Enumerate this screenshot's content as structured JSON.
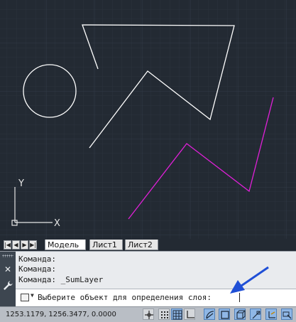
{
  "layout_tabs": [
    {
      "label": "Модель",
      "active": true
    },
    {
      "label": "Лист1",
      "active": false
    },
    {
      "label": "Лист2",
      "active": false
    }
  ],
  "nav_buttons": [
    "first",
    "previous",
    "next",
    "last"
  ],
  "command_history": [
    "Команда:",
    "Команда:",
    "Команда: _SumLayer"
  ],
  "command_prompt": "Выберите объект для определения слоя:",
  "status_bar": {
    "coordinates": "1253.1179, 1256.3477, 0.0000",
    "toggles": [
      {
        "name": "infer-constraints",
        "on": false
      },
      {
        "name": "snap-mode",
        "on": false
      },
      {
        "name": "grid-display",
        "on": true
      },
      {
        "name": "ortho-mode",
        "on": false
      },
      {
        "name": "polar-tracking",
        "on": true
      },
      {
        "name": "object-snap",
        "on": true
      },
      {
        "name": "3d-object-snap",
        "on": true
      },
      {
        "name": "object-snap-tracking",
        "on": true
      },
      {
        "name": "dynamic-ucs",
        "on": true
      },
      {
        "name": "dynamic-input",
        "on": true
      }
    ]
  },
  "colors": {
    "canvas_background": "#232a33",
    "white_layer": "#ffffff",
    "magenta_layer": "#e020d8",
    "pointer_arrow": "#1f4fd6"
  },
  "ucs_icon": {
    "x_label": "X",
    "y_label": "Y"
  }
}
